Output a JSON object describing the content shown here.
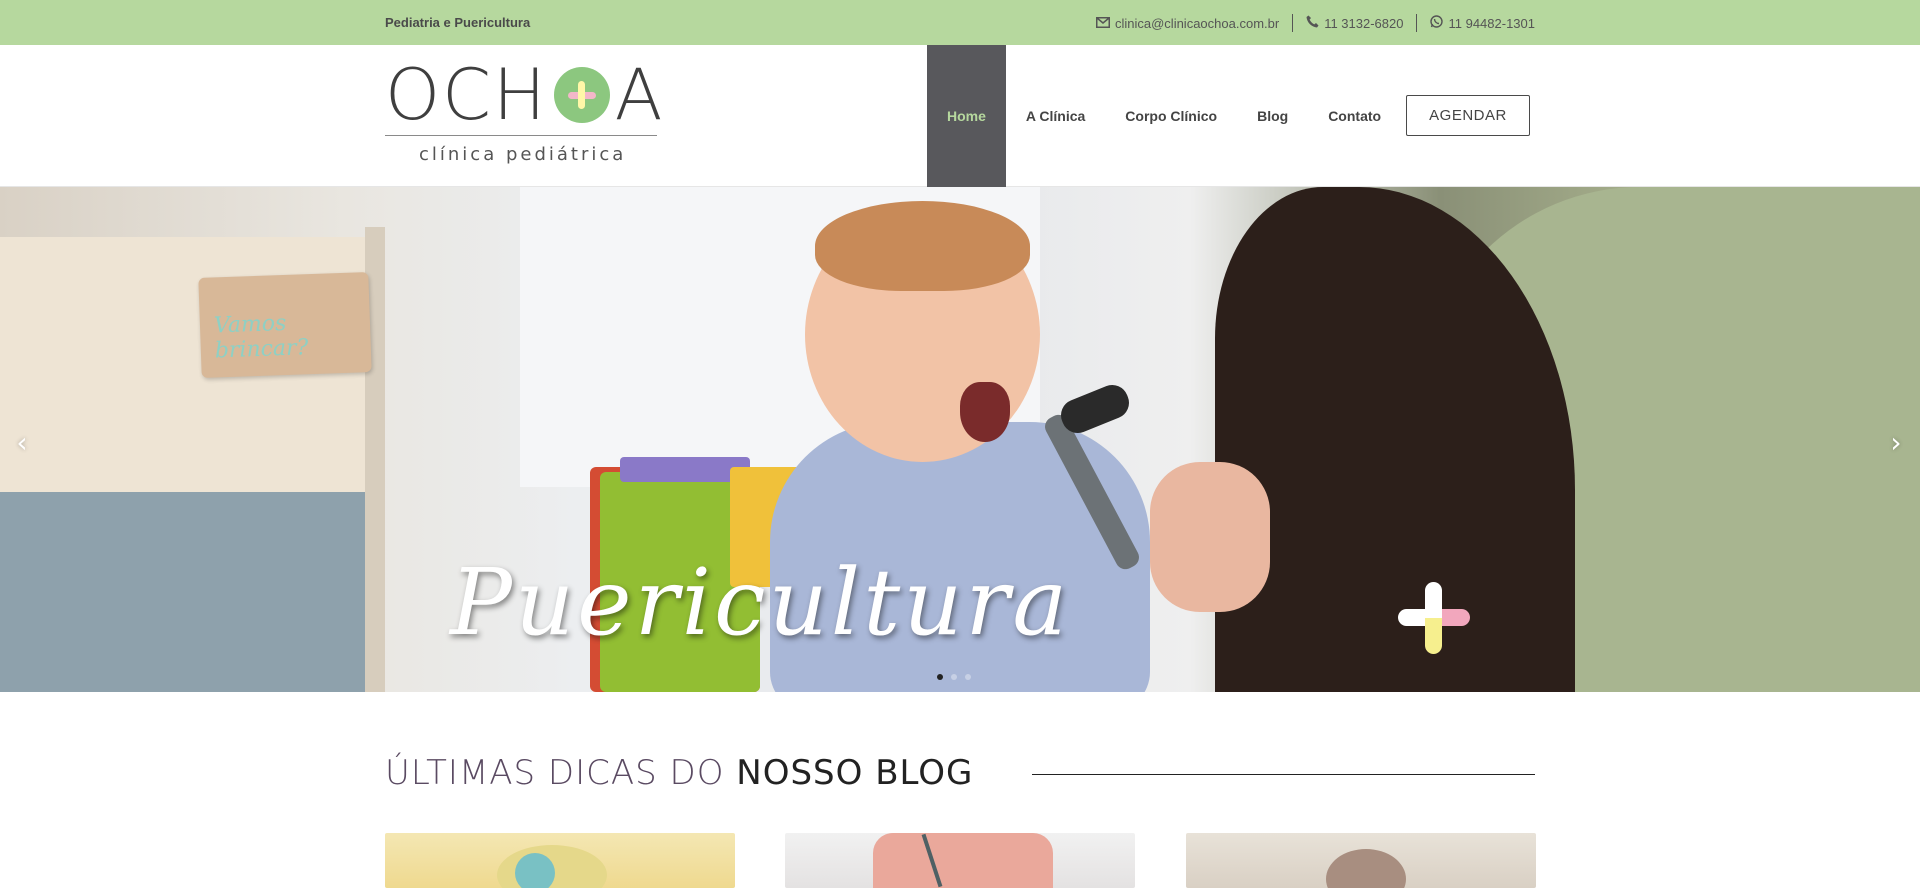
{
  "topbar": {
    "tagline": "Pediatria e Puericultura",
    "email": "clinica@clinicaochoa.com.br",
    "phone": "11 3132-6820",
    "whatsapp": "11 94482-1301",
    "background": "#b6d89e"
  },
  "logo": {
    "letters_left": "OCH",
    "letters_right": "A",
    "subtitle": "clínica pediátrica",
    "o_color": "#8cc77f"
  },
  "nav": {
    "items": [
      {
        "label": "Home",
        "active": true
      },
      {
        "label": "A Clínica",
        "active": false
      },
      {
        "label": "Corpo Clínico",
        "active": false
      },
      {
        "label": "Blog",
        "active": false
      },
      {
        "label": "Contato",
        "active": false
      }
    ],
    "cta_label": "AGENDAR",
    "active_bg": "#58585c",
    "active_text": "#b6d89e"
  },
  "hero": {
    "title": "Puericultura",
    "sign_text": "Vamos brincar?",
    "prev_icon": "chevron-left-icon",
    "next_icon": "chevron-right-icon",
    "slide_count": 3,
    "active_slide": 1
  },
  "blog": {
    "heading_light": "ÚLTIMAS DICAS DO ",
    "heading_strong": "NOSSO BLOG"
  },
  "icons": {
    "email": "envelope-icon",
    "phone": "phone-icon",
    "whatsapp": "whatsapp-icon"
  }
}
